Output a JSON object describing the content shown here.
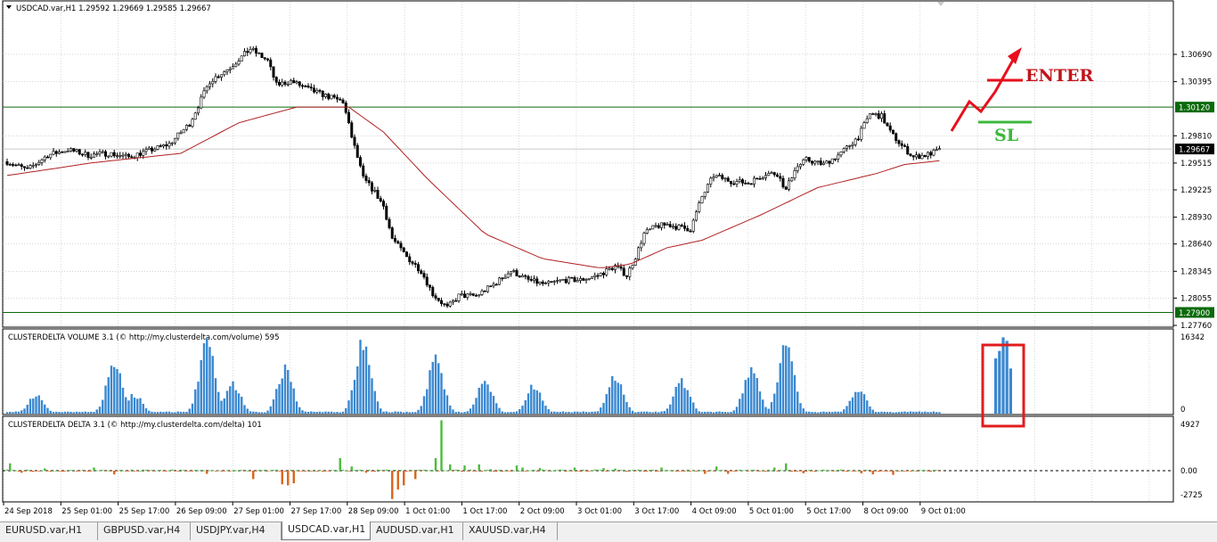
{
  "chart_data": {
    "type": "candlestick",
    "symbol_header": "USDCAD.var,H1  1.29592 1.29669 1.29585 1.29667",
    "price_axis": {
      "ticks": [
        "1.30690",
        "1.30395",
        "1.29810",
        "1.29515",
        "1.29225",
        "1.28930",
        "1.28640",
        "1.28345",
        "1.28055",
        "1.27760"
      ],
      "ylim": [
        1.2776,
        1.3095
      ],
      "horizontal_lines": [
        {
          "label": "1.30120",
          "value": 1.3012,
          "color": "#0a6a0a"
        },
        {
          "label": "1.27900",
          "value": 1.279,
          "color": "#0a6a0a"
        }
      ],
      "current_price": {
        "label": "1.29667",
        "value": 1.29667
      }
    },
    "time_axis": {
      "ticks": [
        "24 Sep 2018",
        "25 Sep 01:00",
        "25 Sep 17:00",
        "26 Sep 09:00",
        "27 Sep 01:00",
        "27 Sep 17:00",
        "28 Sep 09:00",
        "1 Oct 01:00",
        "1 Oct 17:00",
        "2 Oct 09:00",
        "3 Oct 01:00",
        "3 Oct 17:00",
        "4 Oct 09:00",
        "5 Oct 01:00",
        "5 Oct 17:00",
        "8 Oct 09:00",
        "9 Oct 01:00"
      ]
    },
    "close_path": [
      [
        0,
        1.2953
      ],
      [
        7,
        1.2944
      ],
      [
        14,
        1.296
      ],
      [
        21,
        1.2966
      ],
      [
        28,
        1.296
      ],
      [
        35,
        1.2962
      ],
      [
        42,
        1.2958
      ],
      [
        49,
        1.2965
      ],
      [
        56,
        1.2972
      ],
      [
        63,
        1.2994
      ],
      [
        70,
        1.304
      ],
      [
        77,
        1.3055
      ],
      [
        84,
        1.3075
      ],
      [
        90,
        1.3062
      ],
      [
        93,
        1.3036
      ],
      [
        98,
        1.304
      ],
      [
        105,
        1.303
      ],
      [
        112,
        1.3022
      ],
      [
        116,
        1.3018
      ],
      [
        119,
        1.298
      ],
      [
        123,
        1.2935
      ],
      [
        127,
        1.292
      ],
      [
        130,
        1.2905
      ],
      [
        133,
        1.287
      ],
      [
        138,
        1.285
      ],
      [
        143,
        1.2835
      ],
      [
        147,
        1.281
      ],
      [
        152,
        1.2795
      ],
      [
        156,
        1.2808
      ],
      [
        162,
        1.2808
      ],
      [
        168,
        1.282
      ],
      [
        174,
        1.2835
      ],
      [
        180,
        1.2825
      ],
      [
        186,
        1.282
      ],
      [
        192,
        1.2825
      ],
      [
        198,
        1.2825
      ],
      [
        204,
        1.283
      ],
      [
        210,
        1.284
      ],
      [
        214,
        1.283
      ],
      [
        217,
        1.285
      ],
      [
        220,
        1.2875
      ],
      [
        224,
        1.2883
      ],
      [
        228,
        1.2885
      ],
      [
        232,
        1.2882
      ],
      [
        236,
        1.288
      ],
      [
        240,
        1.2915
      ],
      [
        244,
        1.2938
      ],
      [
        250,
        1.2932
      ],
      [
        256,
        1.293
      ],
      [
        262,
        1.294
      ],
      [
        266,
        1.294
      ],
      [
        269,
        1.2922
      ],
      [
        272,
        1.2945
      ],
      [
        276,
        1.2955
      ],
      [
        282,
        1.295
      ],
      [
        288,
        1.2962
      ],
      [
        294,
        1.298
      ],
      [
        298,
        1.3005
      ],
      [
        302,
        1.3002
      ],
      [
        305,
        1.2985
      ],
      [
        309,
        1.297
      ],
      [
        313,
        1.2958
      ],
      [
        317,
        1.296
      ],
      [
        322,
        1.2965
      ]
    ],
    "moving_average": [
      [
        0,
        1.2938
      ],
      [
        30,
        1.2952
      ],
      [
        60,
        1.2962
      ],
      [
        80,
        1.2995
      ],
      [
        100,
        1.3012
      ],
      [
        118,
        1.3012
      ],
      [
        130,
        1.2985
      ],
      [
        145,
        1.2935
      ],
      [
        165,
        1.2875
      ],
      [
        185,
        1.2848
      ],
      [
        205,
        1.2838
      ],
      [
        215,
        1.2842
      ],
      [
        228,
        1.286
      ],
      [
        240,
        1.2868
      ],
      [
        260,
        1.2895
      ],
      [
        280,
        1.2925
      ],
      [
        300,
        1.294
      ],
      [
        310,
        1.295
      ],
      [
        322,
        1.2954
      ]
    ],
    "annotations": {
      "enter_label": "ENTER",
      "sl_label": "SL"
    },
    "volume_panel": {
      "title": "CLUSTERDELTA VOLUME 3.1 (© http://my.clusterdelta.com/volume) 595",
      "ticks": [
        "16342",
        "0"
      ],
      "ylim": [
        0,
        16342
      ],
      "peaks": [
        [
          10,
          4100
        ],
        [
          37,
          10800
        ],
        [
          44,
          4200
        ],
        [
          69,
          15500
        ],
        [
          78,
          6500
        ],
        [
          96,
          9800
        ],
        [
          123,
          15900
        ],
        [
          148,
          12000
        ],
        [
          165,
          7000
        ],
        [
          182,
          6200
        ],
        [
          210,
          8100
        ],
        [
          233,
          7200
        ],
        [
          257,
          9800
        ],
        [
          269,
          14900
        ],
        [
          294,
          5200
        ]
      ],
      "highlighted_bars": [
        11000,
        12500,
        15200,
        14500,
        9000
      ]
    },
    "delta_panel": {
      "title": "CLUSTERDELTA DELTA 3.1 (© http://my.clusterdelta.com/delta) 101",
      "ticks": [
        "4927",
        "0.00",
        "-2725"
      ],
      "ylim": [
        -2725,
        4927
      ],
      "spikes": [
        [
          1,
          700
        ],
        [
          5,
          -200
        ],
        [
          13,
          220
        ],
        [
          30,
          300
        ],
        [
          37,
          -350
        ],
        [
          69,
          -300
        ],
        [
          85,
          -800
        ],
        [
          95,
          -1300
        ],
        [
          97,
          -1400
        ],
        [
          99,
          -1200
        ],
        [
          115,
          1200
        ],
        [
          119,
          400
        ],
        [
          124,
          -200
        ],
        [
          133,
          -2700
        ],
        [
          135,
          -1800
        ],
        [
          137,
          -1400
        ],
        [
          141,
          -800
        ],
        [
          148,
          1200
        ],
        [
          150,
          4800
        ],
        [
          153,
          600
        ],
        [
          158,
          500
        ],
        [
          163,
          600
        ],
        [
          167,
          150
        ],
        [
          176,
          500
        ],
        [
          178,
          300
        ],
        [
          184,
          250
        ],
        [
          196,
          300
        ],
        [
          206,
          250
        ],
        [
          210,
          200
        ],
        [
          226,
          300
        ],
        [
          241,
          -300
        ],
        [
          245,
          400
        ],
        [
          249,
          -300
        ],
        [
          265,
          300
        ],
        [
          269,
          700
        ],
        [
          275,
          -250
        ],
        [
          295,
          -250
        ],
        [
          299,
          -350
        ],
        [
          306,
          -400
        ]
      ]
    },
    "grid": true
  },
  "tabs": [
    "EURUSD.var,H1",
    "GBPUSD.var,H4",
    "USDJPY.var,H4",
    "USDCAD.var,H1",
    "AUDUSD.var,H1",
    "XAUUSD.var,H4"
  ],
  "active_tab": "USDCAD.var,H1"
}
